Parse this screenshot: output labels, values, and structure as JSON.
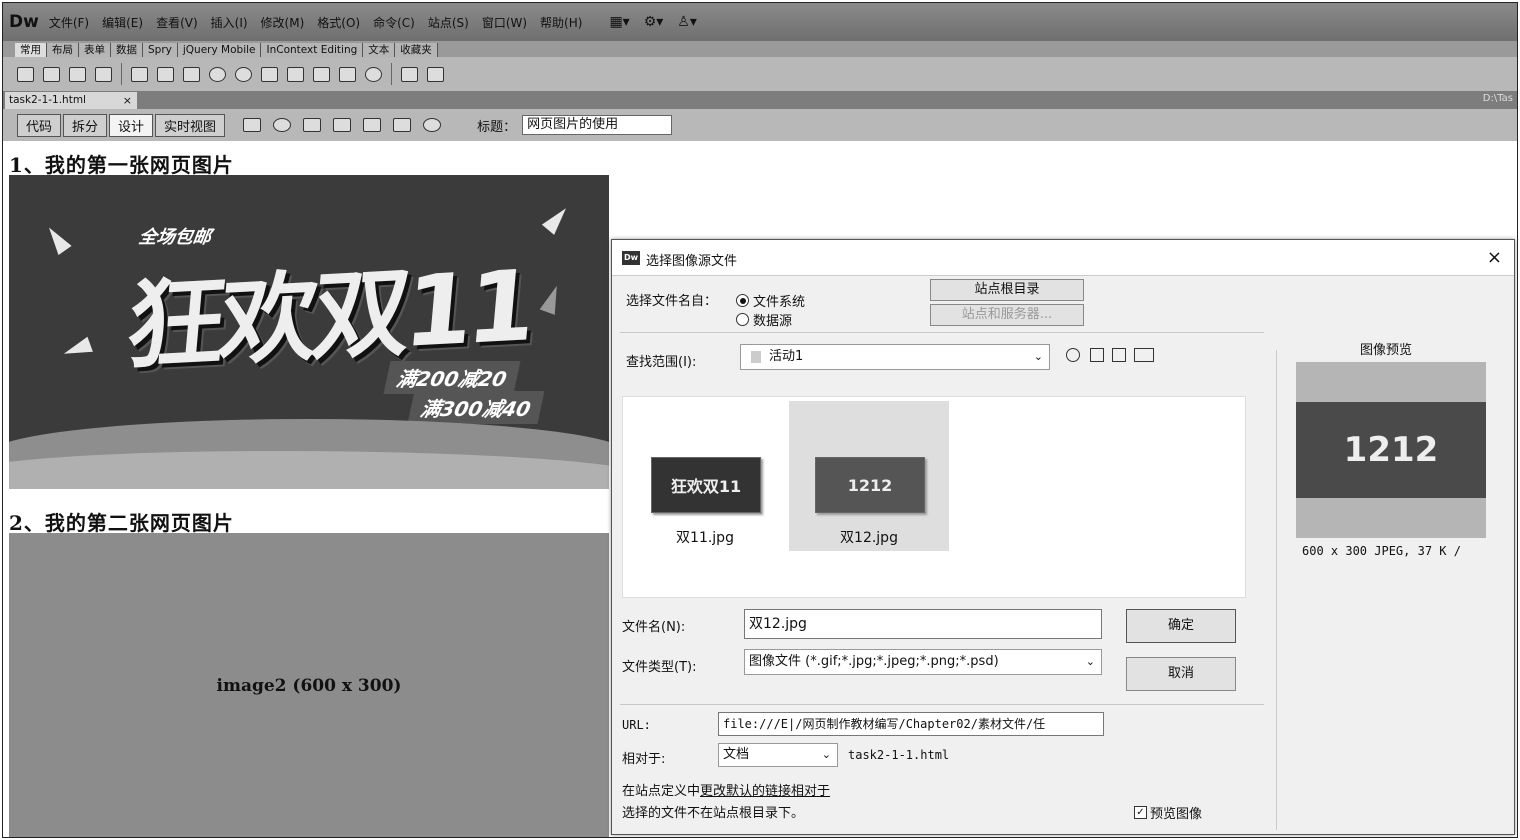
{
  "app": {
    "logo": "Dw",
    "menu": [
      "文件(F)",
      "编辑(E)",
      "查看(V)",
      "插入(I)",
      "修改(M)",
      "格式(O)",
      "命令(C)",
      "站点(S)",
      "窗口(W)",
      "帮助(H)"
    ],
    "menu_tools": [
      "▦▾",
      "⚙▾",
      "♙▾"
    ]
  },
  "insert_tabs": [
    "常用",
    "布局",
    "表单",
    "数据",
    "Spry",
    "jQuery Mobile",
    "InContext Editing",
    "文本",
    "收藏夹"
  ],
  "document": {
    "tab_name": "task2-1-1.html",
    "tab_close": "×",
    "path_fragment": "D:\\Tas",
    "view_buttons": [
      "代码",
      "拆分",
      "设计",
      "实时视图"
    ],
    "active_view": "设计",
    "title_label": "标题：",
    "title_value": "网页图片的使用"
  },
  "content": {
    "heading1": "1、我的第一张网页图片",
    "banner1": {
      "subtitle": "全场包邮",
      "title": "狂欢双11",
      "line1": "满200减20",
      "line2": "满300减40"
    },
    "heading2": "2、我的第二张网页图片",
    "placeholder_label": "image2 (600 x 300)"
  },
  "dialog": {
    "icon_text": "Dw",
    "title": "选择图像源文件",
    "close": "×",
    "select_from_label": "选择文件名自：",
    "radio_filesystem": "文件系统",
    "radio_datasource": "数据源",
    "site_root_button": "站点根目录",
    "site_server_button": "站点和服务器...",
    "lookin_label": "查找范围(I):",
    "lookin_value": "活动1",
    "files": [
      {
        "name": "双11.jpg",
        "thumb_text": "狂欢双11",
        "selected": false
      },
      {
        "name": "双12.jpg",
        "thumb_text": "1212",
        "selected": true
      }
    ],
    "filename_label": "文件名(N):",
    "filename_value": "双12.jpg",
    "filetype_label": "文件类型(T):",
    "filetype_value": "图像文件 (*.gif;*.jpg;*.jpeg;*.png;*.psd)",
    "ok_button": "确定",
    "cancel_button": "取消",
    "url_label": "URL:",
    "url_value": "file:///E|/网页制作教材编写/Chapter02/素材文件/任",
    "relative_label": "相对于:",
    "relative_value": "文档",
    "relative_file": "task2-1-1.html",
    "note_prefix": "在站点定义中",
    "note_link": "更改默认的链接相对于",
    "note_warning": "选择的文件不在站点根目录下。",
    "preview_checkbox": "预览图像",
    "preview_checked": true,
    "preview_title": "图像预览",
    "preview_thumb_text": "1212",
    "preview_info": "600 x 300 JPEG, 37 K /"
  }
}
